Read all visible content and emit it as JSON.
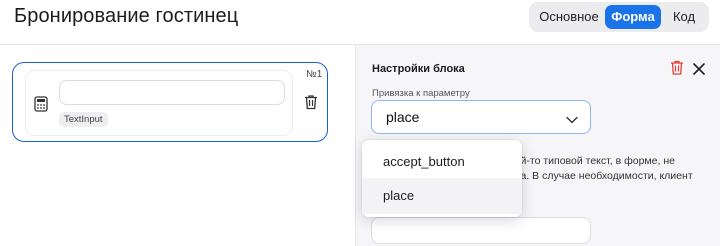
{
  "header": {
    "title": "Бронирование гостинец",
    "tabs": [
      {
        "label": "Основное",
        "active": false
      },
      {
        "label": "Форма",
        "active": true
      },
      {
        "label": "Код",
        "active": false
      }
    ],
    "accent_color": "#1a73e8"
  },
  "canvas": {
    "block": {
      "number": "№1",
      "type_badge": "TextInput",
      "input_value": "",
      "left_icon": "calculator-icon",
      "action_icon": "trash-icon"
    }
  },
  "settings": {
    "title": "Настройки блока",
    "binding_label": "Привязка к параметру",
    "selected_value": "place",
    "dropdown_options": [
      "accept_button",
      "place"
    ],
    "description_line1": "кой-то типовой текст, в форме, не",
    "description_line2": "нта. В случае необходимости, клиент",
    "delete_icon": "trash-icon",
    "delete_color": "#e0403a",
    "close_icon": "close-icon"
  }
}
